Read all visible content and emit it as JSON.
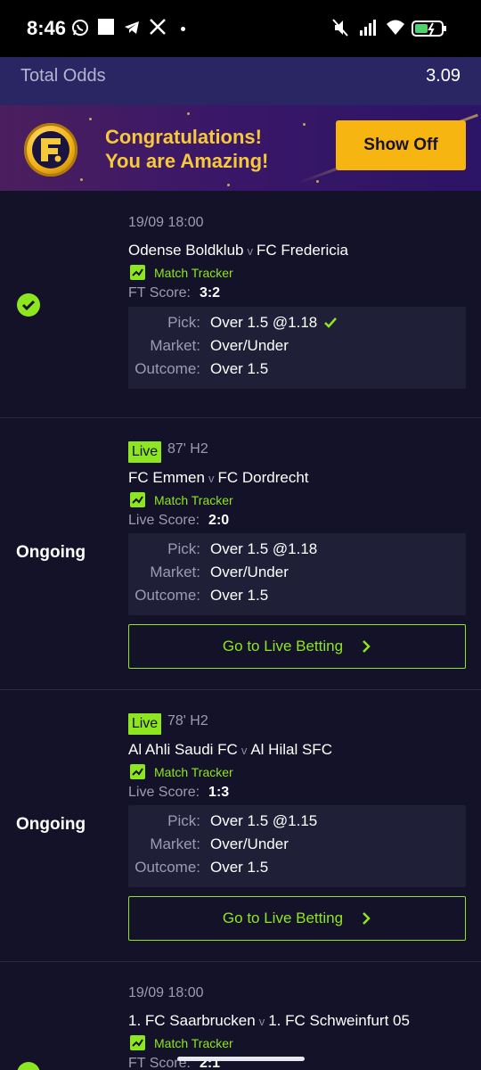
{
  "status_bar": {
    "time": "8:46"
  },
  "summary": {
    "total_odds_label": "Total Odds",
    "total_odds_value": "3.09"
  },
  "banner": {
    "logo_letter": "F.",
    "line1": "Congratulations!",
    "line2": "You are Amazing!",
    "button_label": "Show Off"
  },
  "labels": {
    "match_tracker": "Match Tracker",
    "pick": "Pick:",
    "market": "Market:",
    "outcome": "Outcome:",
    "live_button": "Go to Live Betting",
    "live_badge": "Live",
    "vs": "v"
  },
  "bets": [
    {
      "status": "won",
      "time": "19/09 18:00",
      "home": "Odense Boldklub",
      "away": "FC Fredericia",
      "score_label": "FT Score:",
      "score": "3:2",
      "pick": "Over 1.5 @1.18",
      "market": "Over/Under",
      "outcome": "Over 1.5"
    },
    {
      "status": "Ongoing",
      "live_time": "87' H2",
      "home": "FC Emmen",
      "away": "FC Dordrecht",
      "score_label": "Live Score:",
      "score": "2:0",
      "pick": "Over 1.5 @1.18",
      "market": "Over/Under",
      "outcome": "Over 1.5"
    },
    {
      "status": "Ongoing",
      "live_time": "78' H2",
      "home": "Al Ahli Saudi FC",
      "away": "Al Hilal SFC",
      "score_label": "Live Score:",
      "score": "1:3",
      "pick": "Over 1.5 @1.15",
      "market": "Over/Under",
      "outcome": "Over 1.5"
    },
    {
      "status": "won",
      "time": "19/09 18:00",
      "home": "1. FC Saarbrucken",
      "away": "1. FC Schweinfurt 05",
      "score_label": "FT Score:",
      "score": "2:1"
    }
  ],
  "colors": {
    "accent": "#8ee620",
    "banner_button": "#f6b511",
    "background": "#131229",
    "summary_bar": "#2a2663"
  }
}
